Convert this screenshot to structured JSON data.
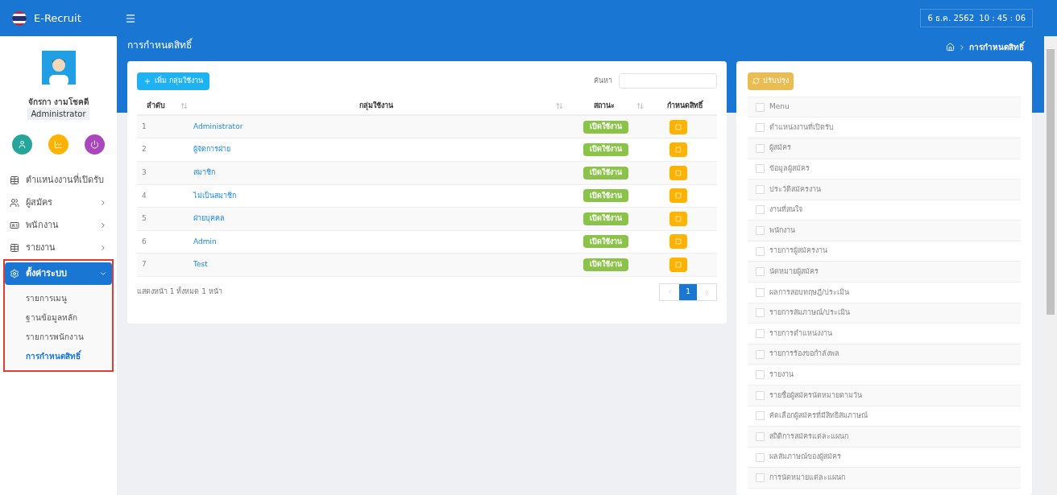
{
  "app": {
    "title": "E-Recruit",
    "datetime": "6 ธ.ค. 2562  10 : 45 : 06"
  },
  "user": {
    "name": "จักรกา งามโชคดี",
    "role": "Administrator"
  },
  "sidebar": {
    "items": [
      {
        "label": "ตำแหน่งงานที่เปิดรับ",
        "kind": "table",
        "has_arrow": false,
        "expanded": false,
        "selected": false
      },
      {
        "label": "ผู้สมัคร",
        "kind": "people",
        "has_arrow": true,
        "expanded": false,
        "selected": false
      },
      {
        "label": "พนักงาน",
        "kind": "badge",
        "has_arrow": true,
        "expanded": false,
        "selected": false
      },
      {
        "label": "รายงาน",
        "kind": "table",
        "has_arrow": true,
        "expanded": false,
        "selected": false
      },
      {
        "label": "ตั้งค่าระบบ",
        "kind": "gear",
        "has_arrow": true,
        "expanded": true,
        "selected": true,
        "children": [
          {
            "label": "รายการเมนู",
            "selected": false
          },
          {
            "label": "ฐานข้อมูลหลัก",
            "selected": false
          },
          {
            "label": "รายการพนักงาน",
            "selected": false
          },
          {
            "label": "การกำหนดสิทธิ์",
            "selected": true
          }
        ]
      }
    ]
  },
  "page": {
    "title": "การกำหนดสิทธิ์",
    "breadcrumb": "การกำหนดสิทธิ์"
  },
  "groups_card": {
    "add_button": "เพิ่ม กลุ่มใช้งาน",
    "search_label": "ค้นหา",
    "table": {
      "columns": [
        "ลำดับ",
        "กลุ่มใช้งาน",
        "สถานะ",
        "กำหนดสิทธิ์"
      ],
      "rows": [
        {
          "no": "1",
          "name": "Administrator",
          "status": "เปิดใช้งาน",
          "enabled": true
        },
        {
          "no": "2",
          "name": "ผู้จัดการฝ่าย",
          "status": "เปิดใช้งาน",
          "enabled": true
        },
        {
          "no": "3",
          "name": "สมาชิก",
          "status": "เปิดใช้งาน",
          "enabled": true
        },
        {
          "no": "4",
          "name": "ไม่เป็นสมาชิก",
          "status": "เปิดใช้งาน",
          "enabled": true
        },
        {
          "no": "5",
          "name": "ฝ่ายบุคคล",
          "status": "เปิดใช้งาน",
          "enabled": true
        },
        {
          "no": "6",
          "name": "Admin",
          "status": "เปิดใช้งาน",
          "enabled": true
        },
        {
          "no": "7",
          "name": "Test",
          "status": "เปิดใช้งาน",
          "enabled": true
        }
      ]
    },
    "page_info": "แสดงหน้า 1 ทั้งหมด 1 หน้า",
    "pagination": [
      {
        "label": "1",
        "selected": true
      }
    ]
  },
  "permissions_card": {
    "update_button": "ปรับปรุง",
    "items": [
      {
        "label": "Menu",
        "checked": false
      },
      {
        "label": "ตำแหน่งงานที่เปิดรับ",
        "checked": false
      },
      {
        "label": "ผู้สมัคร",
        "checked": false
      },
      {
        "label": "ข้อมูลผู้สมัคร",
        "checked": false
      },
      {
        "label": "ประวัติสมัครงาน",
        "checked": false
      },
      {
        "label": "งานที่สนใจ",
        "checked": false
      },
      {
        "label": "พนักงาน",
        "checked": false
      },
      {
        "label": "รายการผู้สมัครงาน",
        "checked": false
      },
      {
        "label": "นัดหมายผู้สมัคร",
        "checked": false
      },
      {
        "label": "ผลการสอบทฤษฎี/ประเมิน",
        "checked": false
      },
      {
        "label": "รายการสัมภาษณ์/ประเมิน",
        "checked": false
      },
      {
        "label": "รายการตำแหน่งงาน",
        "checked": false
      },
      {
        "label": "รายการร้องขอกำลังพล",
        "checked": false
      },
      {
        "label": "รายงาน",
        "checked": false
      },
      {
        "label": "รายชื่อผู้สมัครนัดหมายตามวัน",
        "checked": false
      },
      {
        "label": "คัดเลือกผู้สมัครที่มีสิทธิสัมภาษณ์",
        "checked": false
      },
      {
        "label": "สถิติการสมัครแต่ละแผนก",
        "checked": false
      },
      {
        "label": "ผลสัมภาษณ์ของผู้สมัคร",
        "checked": false
      },
      {
        "label": "การนัดหมายแต่ละแผนก",
        "checked": false
      }
    ]
  }
}
